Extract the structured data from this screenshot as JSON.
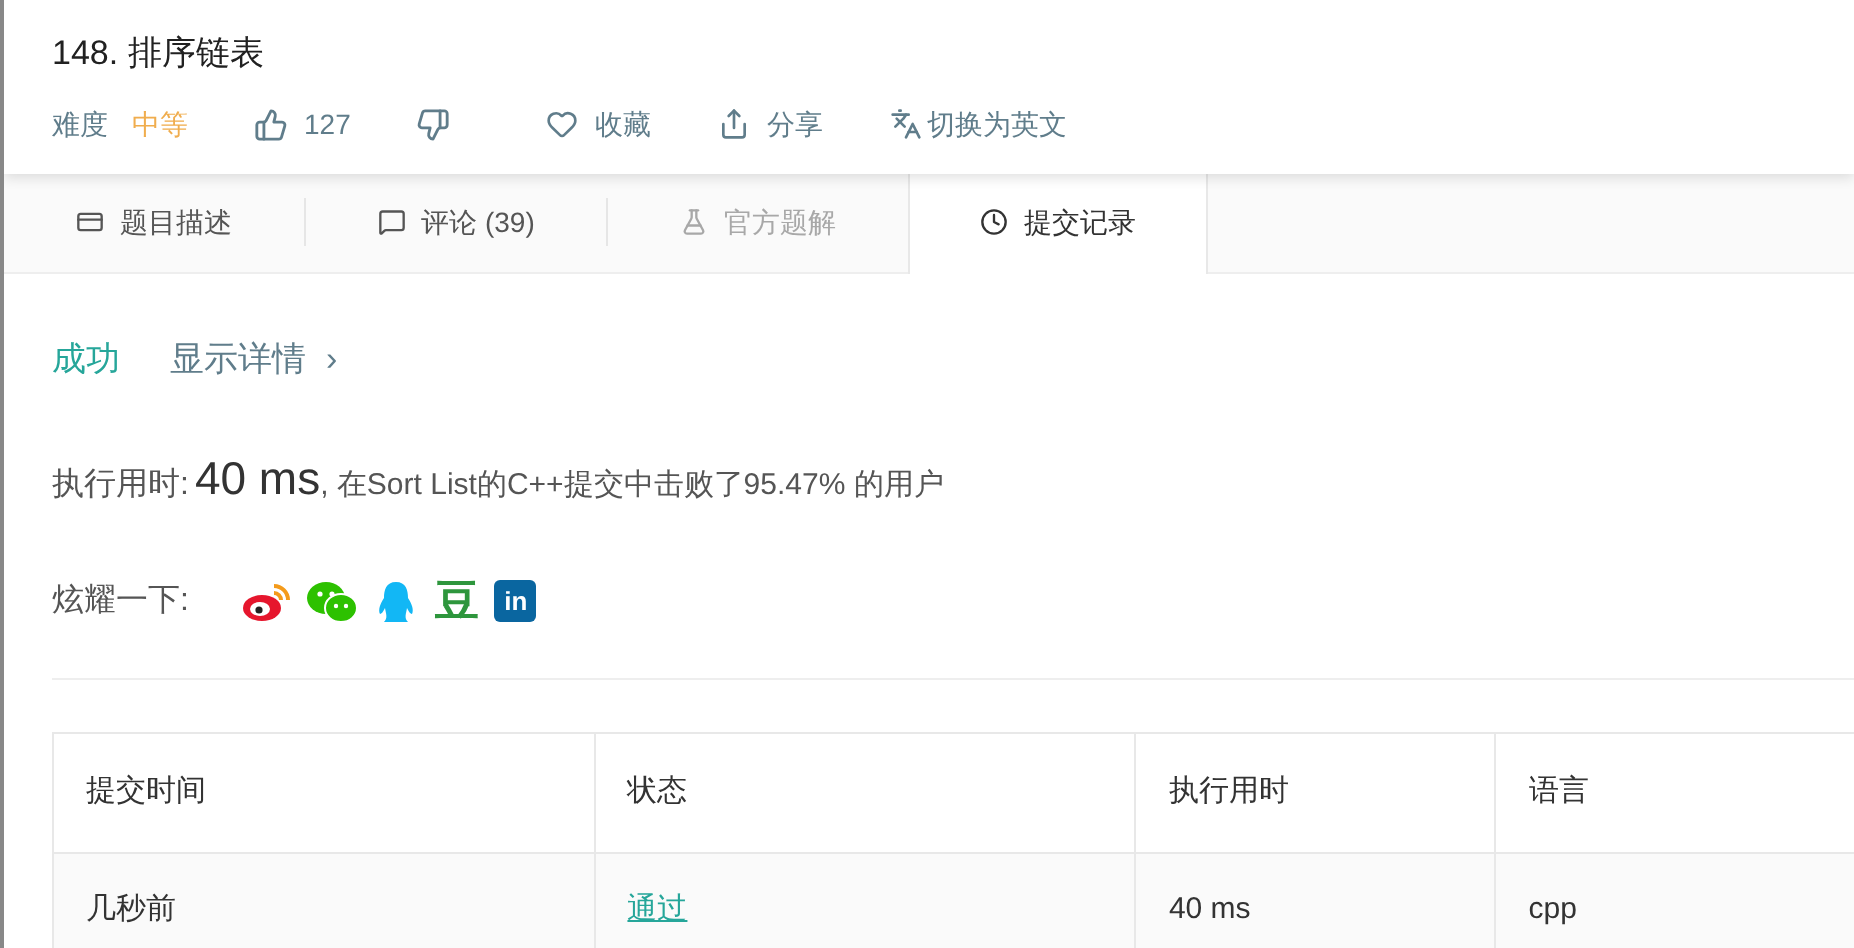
{
  "problem": {
    "title": "148. 排序链表",
    "difficulty_label": "难度",
    "difficulty": {
      "label": "中等",
      "kind": "medium"
    },
    "likes": "127",
    "favorite": "收藏",
    "share": "分享",
    "translate": "切换为英文"
  },
  "tabs": [
    {
      "label": "题目描述",
      "kind": "description",
      "selected": false,
      "disabled": false
    },
    {
      "label": "评论 (39)",
      "kind": "comment",
      "selected": false,
      "disabled": false
    },
    {
      "label": "官方题解",
      "kind": "flask",
      "selected": false,
      "disabled": true
    },
    {
      "label": "提交记录",
      "kind": "clock",
      "selected": true,
      "disabled": false
    }
  ],
  "result": {
    "status": "成功",
    "kind": "success",
    "details_link": "显示详情",
    "chevron": "›"
  },
  "runtime_line": {
    "label": "执行用时: ",
    "value": "40 ms",
    "rest": ", 在Sort List的C++提交中击败了95.47% 的用户"
  },
  "share_row": {
    "label": "炫耀一下:",
    "buttons": [
      {
        "kind": "weibo"
      },
      {
        "kind": "wechat"
      },
      {
        "kind": "qq"
      },
      {
        "kind": "douban",
        "label": "豆"
      },
      {
        "kind": "linkedin",
        "label": "in"
      }
    ]
  },
  "table": {
    "columns": [
      "提交时间",
      "状态",
      "执行用时",
      "语言"
    ],
    "rows": [
      {
        "time": "几秒前",
        "status": "通过",
        "accepted": true,
        "runtime": "40 ms",
        "language": "cpp"
      }
    ]
  }
}
